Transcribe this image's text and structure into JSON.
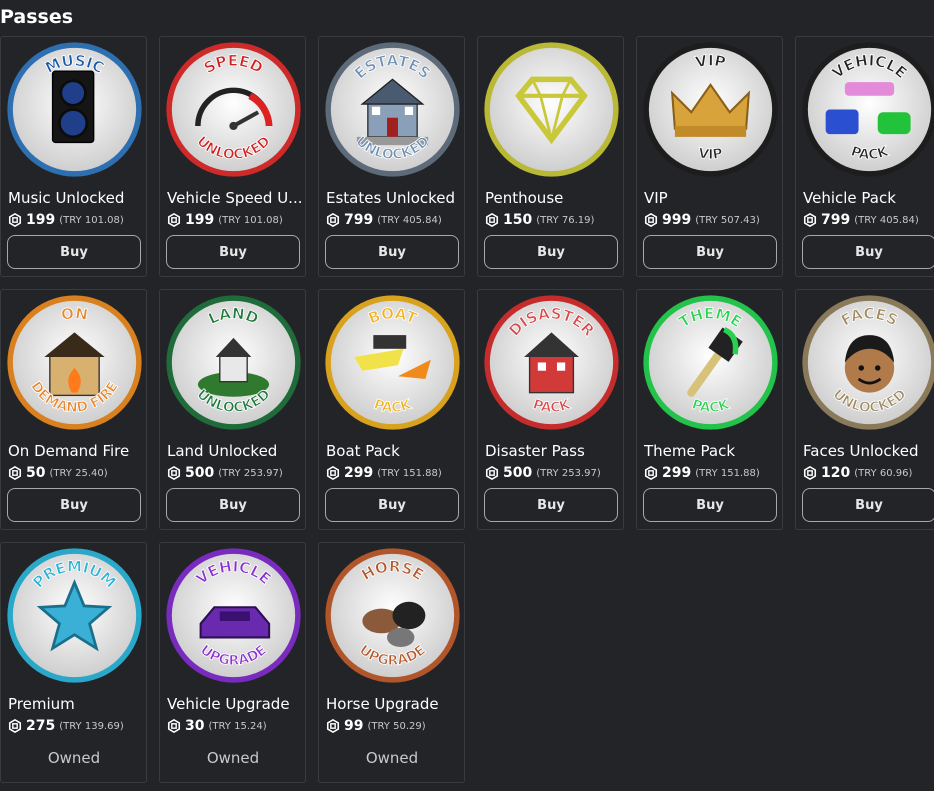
{
  "section": {
    "title": "Passes"
  },
  "colors": {
    "background": "#232427",
    "card_border": "#393b3f",
    "button_border": "#a7a7a8"
  },
  "passes": [
    {
      "name": "Music Unlocked",
      "price": "199",
      "try": "(TRY 101.08)",
      "action": "Buy",
      "badge_text_top": "MUSIC",
      "badge_text_bottom": "",
      "ring": "#2d6fb0",
      "text_color": "#1c5aa8",
      "icon": "speaker-icon"
    },
    {
      "name": "Vehicle Speed U...",
      "price": "199",
      "try": "(TRY 101.08)",
      "action": "Buy",
      "badge_text_top": "SPEED",
      "badge_text_bottom": "UNLOCKED",
      "ring": "#cf2a2a",
      "text_color": "#d11f1f",
      "icon": "speedometer-icon"
    },
    {
      "name": "Estates Unlocked",
      "price": "799",
      "try": "(TRY 405.84)",
      "action": "Buy",
      "badge_text_top": "ESTATES",
      "badge_text_bottom": "UNLOCKED",
      "ring": "#5d6a7a",
      "text_color": "#6f8fb3",
      "icon": "house-icon"
    },
    {
      "name": "Penthouse",
      "price": "150",
      "try": "(TRY 76.19)",
      "action": "Buy",
      "badge_text_top": "",
      "badge_text_bottom": "",
      "ring": "#b9b936",
      "text_color": "#d6d23a",
      "icon": "diamond-icon"
    },
    {
      "name": "VIP",
      "price": "999",
      "try": "(TRY 507.43)",
      "action": "Buy",
      "badge_text_top": "VIP",
      "badge_text_bottom": "VIP",
      "ring": "#1d1d1d",
      "text_color": "#222222",
      "icon": "crown-icon"
    },
    {
      "name": "Vehicle Pack",
      "price": "799",
      "try": "(TRY 405.84)",
      "action": "Buy",
      "badge_text_top": "VEHICLE",
      "badge_text_bottom": "PACK",
      "ring": "#1d1d1d",
      "text_color": "#222222",
      "icon": "cars-icon"
    },
    {
      "name": "On Demand Fire",
      "price": "50",
      "try": "(TRY 25.40)",
      "action": "Buy",
      "badge_text_top": "ON",
      "badge_text_bottom": "DEMAND FIRE",
      "ring": "#d9801f",
      "text_color": "#e8862a",
      "icon": "burning-house-icon"
    },
    {
      "name": "Land Unlocked",
      "price": "500",
      "try": "(TRY 253.97)",
      "action": "Buy",
      "badge_text_top": "LAND",
      "badge_text_bottom": "UNLOCKED",
      "ring": "#1f6b3a",
      "text_color": "#1d7a3a",
      "icon": "land-house-icon"
    },
    {
      "name": "Boat Pack",
      "price": "299",
      "try": "(TRY 151.88)",
      "action": "Buy",
      "badge_text_top": "BOAT",
      "badge_text_bottom": "PACK",
      "ring": "#d8a11e",
      "text_color": "#f0b21f",
      "icon": "boat-icon"
    },
    {
      "name": "Disaster Pass",
      "price": "500",
      "try": "(TRY 253.97)",
      "action": "Buy",
      "badge_text_top": "DISASTER",
      "badge_text_bottom": "PACK",
      "ring": "#c72c2c",
      "text_color": "#d84a4a",
      "icon": "broken-house-icon"
    },
    {
      "name": "Theme Pack",
      "price": "299",
      "try": "(TRY 151.88)",
      "action": "Buy",
      "badge_text_top": "THEME",
      "badge_text_bottom": "PACK",
      "ring": "#23c24a",
      "text_color": "#28d24f",
      "icon": "paintbrush-icon"
    },
    {
      "name": "Faces Unlocked",
      "price": "120",
      "try": "(TRY 60.96)",
      "action": "Buy",
      "badge_text_top": "FACES",
      "badge_text_bottom": "UNLOCKED",
      "ring": "#8a7a5a",
      "text_color": "#a08a60",
      "icon": "face-icon"
    },
    {
      "name": "Premium",
      "price": "275",
      "try": "(TRY 139.69)",
      "action": "Owned",
      "badge_text_top": "PREMIUM",
      "badge_text_bottom": "",
      "ring": "#2aa8c9",
      "text_color": "#2bb3d8",
      "icon": "star-icon"
    },
    {
      "name": "Vehicle Upgrade",
      "price": "30",
      "try": "(TRY 15.24)",
      "action": "Owned",
      "badge_text_top": "VEHICLE",
      "badge_text_bottom": "UPGRADE",
      "ring": "#7a2bbf",
      "text_color": "#8a32d0",
      "icon": "purple-car-icon"
    },
    {
      "name": "Horse Upgrade",
      "price": "99",
      "try": "(TRY 50.29)",
      "action": "Owned",
      "badge_text_top": "HORSE",
      "badge_text_bottom": "UPGRADE",
      "ring": "#b1552a",
      "text_color": "#b65a2d",
      "icon": "horses-icon"
    }
  ]
}
